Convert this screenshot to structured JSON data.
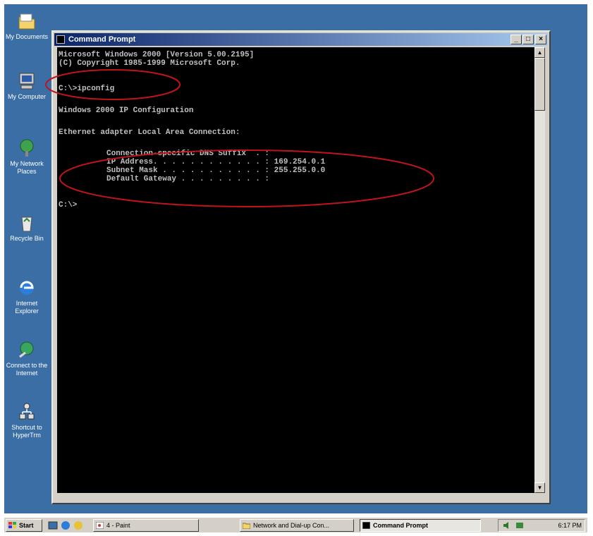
{
  "desktop": {
    "icons": [
      {
        "label": "My Documents",
        "icon": "folder-icon"
      },
      {
        "label": "My Computer",
        "icon": "computer-icon"
      },
      {
        "label": "My Network Places",
        "icon": "network-icon"
      },
      {
        "label": "Recycle Bin",
        "icon": "recycle-bin-icon"
      },
      {
        "label": "Internet Explorer",
        "icon": "ie-icon"
      },
      {
        "label": "Connect to the Internet",
        "icon": "connect-icon"
      },
      {
        "label": "Shortcut to HyperTrm",
        "icon": "shortcut-icon"
      }
    ]
  },
  "window": {
    "title": "Command Prompt",
    "minimize": "_",
    "maximize": "□",
    "close": "×"
  },
  "console": {
    "line1": "Microsoft Windows 2000 [Version 5.00.2195]",
    "line2": "(C) Copyright 1985-1999 Microsoft Corp.",
    "command": "C:\\>ipconfig",
    "config_title": "Windows 2000 IP Configuration",
    "adapter": "Ethernet adapter Local Area Connection:",
    "dns_suffix": "Connection-specific DNS Suffix  . :",
    "ip_address": "IP Address. . . . . . . . . . . . : 169.254.0.1",
    "subnet": "Subnet Mask . . . . . . . . . . . : 255.255.0.0",
    "gateway": "Default Gateway . . . . . . . . . :",
    "prompt": "C:\\>"
  },
  "taskbar": {
    "start": "Start",
    "tasks": [
      {
        "label": "4 - Paint",
        "icon": "paint-icon"
      },
      {
        "label": "Network and Dial-up Con...",
        "icon": "network-folder-icon"
      },
      {
        "label": "Command Prompt",
        "icon": "cmd-icon",
        "active": true
      }
    ],
    "clock": "6:17 PM"
  },
  "colors": {
    "desktop": "#3a6ea5",
    "titlebar": "#0a246a",
    "console_bg": "#000000",
    "annotation": "#c0141c"
  }
}
